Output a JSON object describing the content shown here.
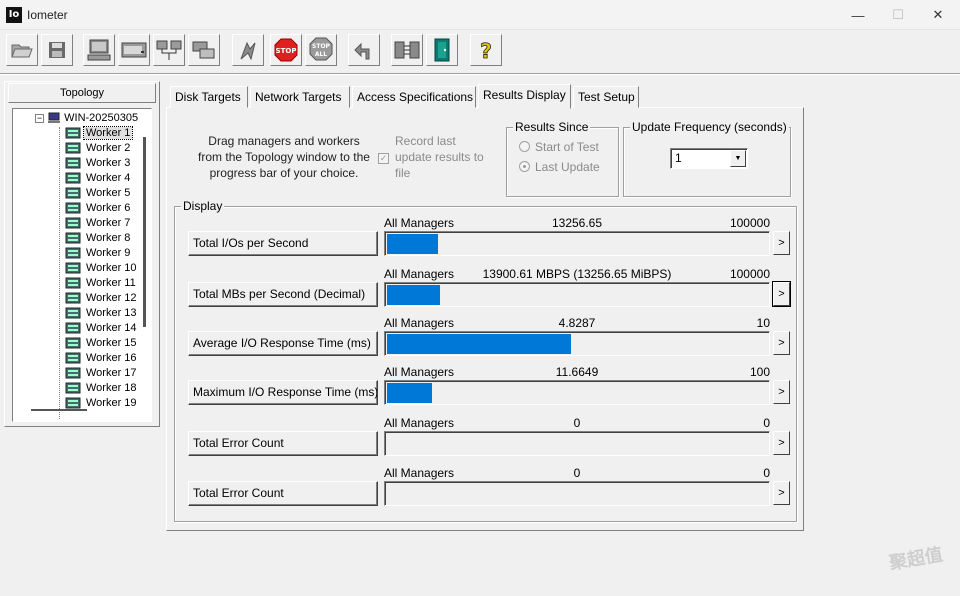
{
  "window": {
    "title": "Iometer",
    "icon_text": "Io",
    "controls": {
      "minimize": "—",
      "maximize": "☐",
      "close": "✕"
    }
  },
  "toolbar": {
    "buttons": [
      {
        "name": "open-config",
        "icon": "folder-open-icon"
      },
      {
        "name": "save-config",
        "icon": "floppy-disk-icon"
      },
      {
        "name": "start-new-manager",
        "icon": "computer-icon"
      },
      {
        "name": "start-new-disk-worker",
        "icon": "disk-worker-icon"
      },
      {
        "name": "start-new-network-worker",
        "icon": "network-worker-icon"
      },
      {
        "name": "duplicate-worker",
        "icon": "duplicate-icon"
      },
      {
        "name": "start-tests",
        "icon": "green-flag-icon"
      },
      {
        "name": "stop",
        "icon": "stop-sign-icon",
        "label": "STOP"
      },
      {
        "name": "stop-all",
        "icon": "stop-all-icon",
        "label": "STOP",
        "sublabel": "ALL"
      },
      {
        "name": "reset-workers",
        "icon": "reset-arrow-icon"
      },
      {
        "name": "disconnect",
        "icon": "disconnect-icon"
      },
      {
        "name": "exit",
        "icon": "exit-door-icon"
      },
      {
        "name": "about",
        "icon": "help-question-icon",
        "label": "?"
      }
    ]
  },
  "topology": {
    "title": "Topology",
    "root_label": "WIN-20250305",
    "expander": "−",
    "workers": [
      "Worker 1",
      "Worker 2",
      "Worker 3",
      "Worker 4",
      "Worker 5",
      "Worker 6",
      "Worker 7",
      "Worker 8",
      "Worker 9",
      "Worker 10",
      "Worker 11",
      "Worker 12",
      "Worker 13",
      "Worker 14",
      "Worker 15",
      "Worker 16",
      "Worker 17",
      "Worker 18",
      "Worker 19"
    ],
    "selected": "Worker 1"
  },
  "tabs": [
    {
      "label": "Disk Targets"
    },
    {
      "label": "Network Targets"
    },
    {
      "label": "Access Specifications"
    },
    {
      "label": "Results Display",
      "active": true
    },
    {
      "label": "Test Setup"
    }
  ],
  "results": {
    "drag_text": "Drag managers and workers from the Topology window to the progress bar of your choice.",
    "record_checkbox": {
      "label": "Record last update results to file",
      "checked": true,
      "mark": "✓"
    },
    "results_since": {
      "label": "Results Since",
      "options": [
        "Start of Test",
        "Last Update"
      ],
      "selected": "Last Update"
    },
    "update_frequency": {
      "label": "Update Frequency (seconds)",
      "value": "1",
      "arrow": "▼"
    },
    "display_label": "Display",
    "metrics": [
      {
        "button": "Total I/Os per Second",
        "manager": "All Managers",
        "value": "13256.65",
        "max": "100000",
        "fill": 0.1326
      },
      {
        "button": "Total MBs per Second (Decimal)",
        "manager": "All Managers",
        "value": "13900.61 MBPS (13256.65 MiBPS)",
        "max": "100000",
        "fill": 0.139
      },
      {
        "button": "Average I/O Response Time (ms)",
        "manager": "All Managers",
        "value": "4.8287",
        "max": "10",
        "fill": 0.4829
      },
      {
        "button": "Maximum I/O Response Time (ms)",
        "manager": "All Managers",
        "value": "11.6649",
        "max": "100",
        "fill": 0.1166
      },
      {
        "button": "Total Error Count",
        "manager": "All Managers",
        "value": "0",
        "max": "0",
        "fill": 0
      },
      {
        "button": "Total Error Count",
        "manager": "All Managers",
        "value": "0",
        "max": "0",
        "fill": 0
      }
    ],
    "arrow_label": ">"
  },
  "colors": {
    "bar": "#0078d7",
    "stop": "#e02020"
  },
  "watermark": "聚超值"
}
